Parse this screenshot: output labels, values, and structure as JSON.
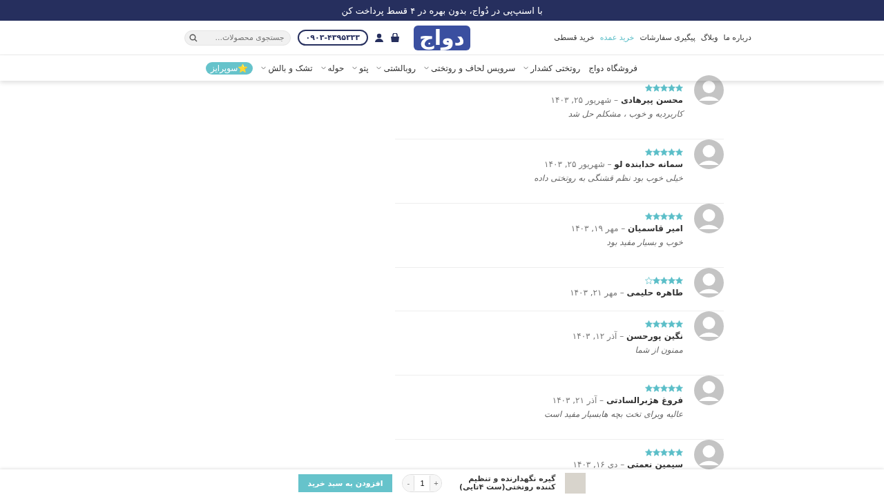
{
  "announcement": "با اسنپ‌پی در دُواج، بدون بهره در ۴ قسط پرداخت کن",
  "header": {
    "links": [
      {
        "label": "درباره ما",
        "highlighted": false
      },
      {
        "label": "وبلاگ",
        "highlighted": false
      },
      {
        "label": "پیگیری سفارشات",
        "highlighted": false
      },
      {
        "label": "خرید عمده",
        "highlighted": true
      },
      {
        "label": "خرید قسطی",
        "highlighted": false
      }
    ],
    "logo": "دواج",
    "search": {
      "placeholder": "جستجوی محصولات..."
    },
    "phone": "۰۹۰۳-۴۳۹۵۳۳۳"
  },
  "nav": [
    {
      "label": "فروشگاه دواج",
      "has_dropdown": false
    },
    {
      "label": "روتختی کشدار",
      "has_dropdown": true
    },
    {
      "label": "سرویس لحاف و روتختی",
      "has_dropdown": true
    },
    {
      "label": "روبالشتی",
      "has_dropdown": true
    },
    {
      "label": "پتو",
      "has_dropdown": true
    },
    {
      "label": "حوله",
      "has_dropdown": true
    },
    {
      "label": "تشک و بالش",
      "has_dropdown": true
    }
  ],
  "nav_badge": {
    "icon": "⭐",
    "label": "سوپرایز"
  },
  "reviews": [
    {
      "stars": 5,
      "author": "محسن پیرهادی",
      "date": "– شهریور ۲۵, ۱۴۰۳",
      "comment": "کاربردیه و خوب ، مشکلم حل شد"
    },
    {
      "stars": 5,
      "author": "سمانه خدابنده لو",
      "date": "– شهریور ۲۵, ۱۴۰۳",
      "comment": "خیلی خوب بود نظم قشنگی به روتختی داده"
    },
    {
      "stars": 5,
      "author": "امیر قاسمیان",
      "date": "– مهر ۱۹, ۱۴۰۳",
      "comment": "خوب و بسیار مفید بود"
    },
    {
      "stars": 4,
      "author": "طاهره حلیمی",
      "date": "– مهر ۲۱, ۱۴۰۳"
    },
    {
      "stars": 5,
      "author": "نگین پورحسن",
      "date": "– آذر ۱۲, ۱۴۰۳",
      "comment": "ممنون از شما"
    },
    {
      "stars": 5,
      "author": "فروغ هژبرالسادتی",
      "date": "– آذر ۲۱, ۱۴۰۳",
      "comment": "عالیه وبرای تخت بچه هابسیار مفید است"
    },
    {
      "stars": 5,
      "author": "سیمین نعمتی",
      "date": "– دی ۱۶, ۱۴۰۳"
    }
  ],
  "sticky_bar": {
    "product_title": "گیره نگهدارنده و تنظیم کننده روتختی(ست ۴تایی)",
    "quantity": "1",
    "decrement": "-",
    "increment": "+",
    "add_button": "افزودن به سبد خرید"
  }
}
